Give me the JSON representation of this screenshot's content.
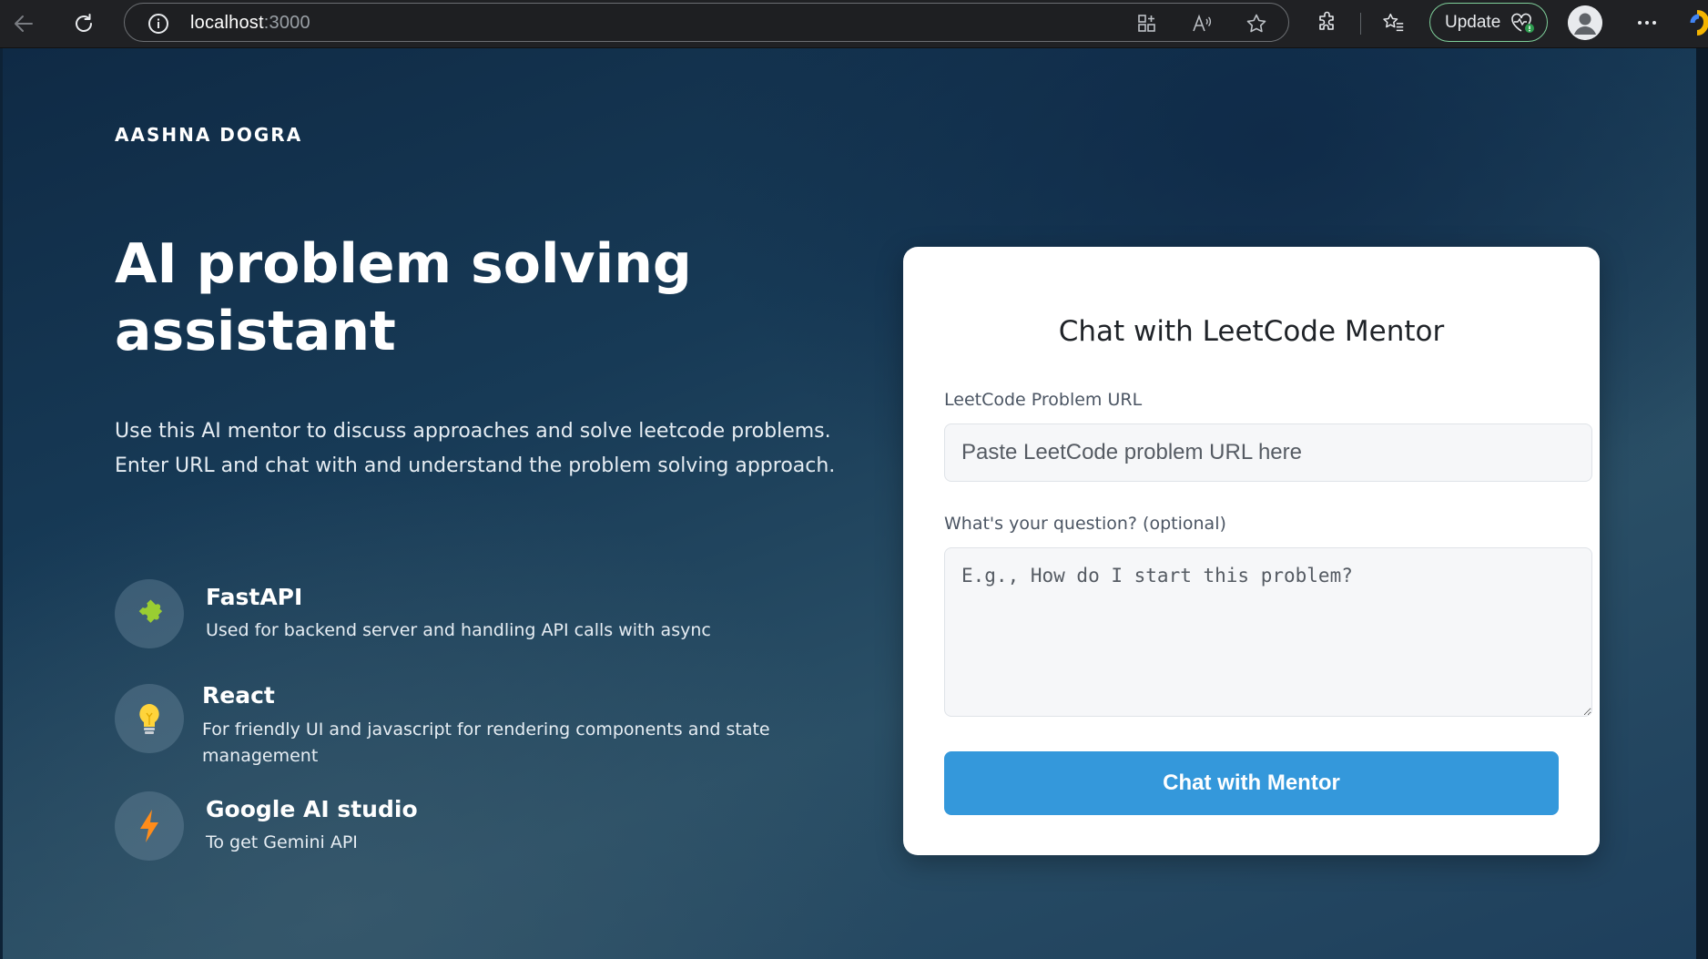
{
  "browser": {
    "url_host": "localhost",
    "url_port": ":3000",
    "update_label": "Update",
    "icons": [
      "back-icon",
      "reload-icon",
      "info-icon",
      "app-grid-icon",
      "read-aloud-icon",
      "favorite-star-icon",
      "extensions-icon",
      "favorites-icon",
      "heart-pulse-icon",
      "profile-icon",
      "more-icon"
    ]
  },
  "brand": "AASHNA DOGRA",
  "hero": {
    "title_line1": "AI problem solving",
    "title_line2": "assistant",
    "desc_line1": "Use this AI mentor to discuss approaches and solve leetcode problems.",
    "desc_line2": "Enter URL and chat with and understand the problem solving approach."
  },
  "features": [
    {
      "title": "FastAPI",
      "desc": "Used for backend server and handling API calls with async",
      "icon": "puzzle-icon",
      "icon_color": "#9acd32"
    },
    {
      "title": "React",
      "desc": "For friendly UI and javascript for rendering components and state management",
      "icon": "lightbulb-icon",
      "icon_color": "#ffd43b"
    },
    {
      "title": "Google AI studio",
      "desc": "To get Gemini API",
      "icon": "lightning-icon",
      "icon_color": "#ff8c1a"
    }
  ],
  "card": {
    "title": "Chat with LeetCode Mentor",
    "url_label": "LeetCode Problem URL",
    "url_placeholder": "Paste LeetCode problem URL here",
    "url_value": "",
    "question_label": "What's your question? (optional)",
    "question_placeholder": "E.g., How do I start this problem?",
    "question_value": "",
    "submit_label": "Chat with Mentor"
  },
  "colors": {
    "accent": "#3498db",
    "update_border": "#7fcf9a"
  }
}
